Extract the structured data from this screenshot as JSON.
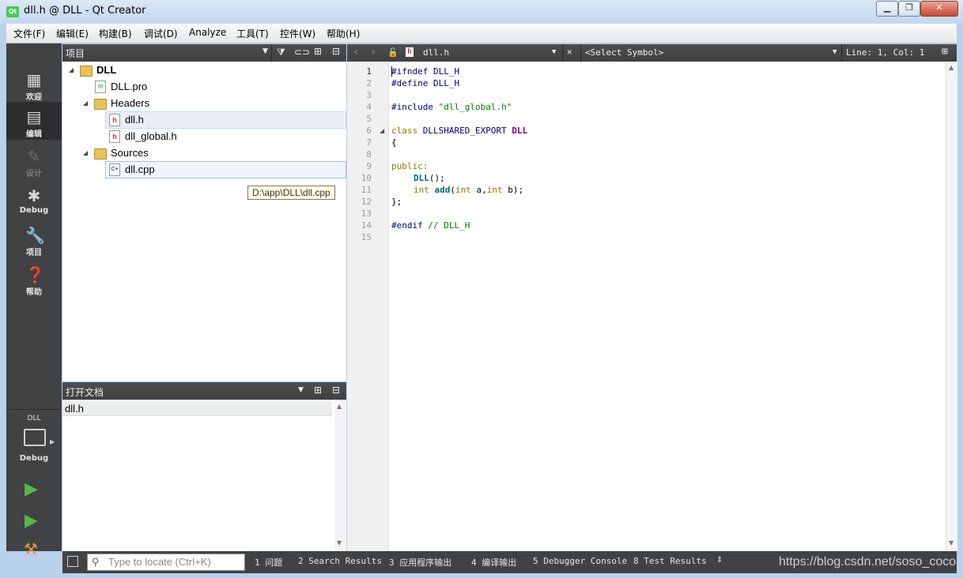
{
  "window": {
    "title": "dll.h @ DLL - Qt Creator",
    "app_icon_text": "Qt"
  },
  "menu": [
    "文件(F)",
    "编辑(E)",
    "构建(B)",
    "调试(D)",
    "Analyze",
    "工具(T)",
    "控件(W)",
    "帮助(H)"
  ],
  "modes": [
    {
      "label": "欢迎",
      "icon": "grid-icon"
    },
    {
      "label": "编辑",
      "icon": "document-icon"
    },
    {
      "label": "设计",
      "icon": "pencil-icon"
    },
    {
      "label": "Debug",
      "icon": "bug-icon"
    },
    {
      "label": "项目",
      "icon": "wrench-icon"
    },
    {
      "label": "帮助",
      "icon": "help-icon"
    }
  ],
  "kit": {
    "project": "DLL",
    "config": "Debug"
  },
  "projects_panel": {
    "title": "项目",
    "tree": {
      "root": "DLL",
      "pro_file": "DLL.pro",
      "headers_label": "Headers",
      "headers": [
        "dll.h",
        "dll_global.h"
      ],
      "sources_label": "Sources",
      "sources": [
        "dll.cpp"
      ]
    },
    "tooltip": "D:\\app\\DLL\\dll.cpp"
  },
  "open_documents": {
    "title": "打开文档",
    "items": [
      "dll.h"
    ]
  },
  "editor": {
    "file_name": "dll.h",
    "symbol": "<Select Symbol>",
    "position": "Line: 1, Col: 1",
    "line_numbers": [
      "1",
      "2",
      "3",
      "4",
      "5",
      "6",
      "7",
      "8",
      "9",
      "10",
      "11",
      "12",
      "13",
      "14",
      "15"
    ],
    "code": {
      "l1": "#ifndef DLL_H",
      "l2": "#define DLL_H",
      "l4a": "#include ",
      "l4b": "\"dll_global.h\"",
      "l6a": "class ",
      "l6b": "DLLSHARED_EXPORT ",
      "l6c": "DLL",
      "l7": "{",
      "l9": "public:",
      "l10a": "DLL",
      "l10b": "();",
      "l11a": "int ",
      "l11b": "add",
      "l11c": "(",
      "l11d": "int",
      "l11e": " a,",
      "l11f": "int",
      "l11g": " b);",
      "l12": "};",
      "l14a": "#endif ",
      "l14b": "// DLL_H"
    }
  },
  "bottom": {
    "locator_placeholder": "Type to locate (Ctrl+K)",
    "tabs": [
      "1 问题",
      "2 Search Results",
      "3 应用程序输出",
      "4 编译输出",
      "5 Debugger Console",
      "8 Test Results"
    ],
    "watermark": "https://blog.csdn.net/soso_coco"
  },
  "colors": {
    "mode_bar": "#404244",
    "panel_header": "#3e4042",
    "title_bar": "#c2d7ee"
  }
}
